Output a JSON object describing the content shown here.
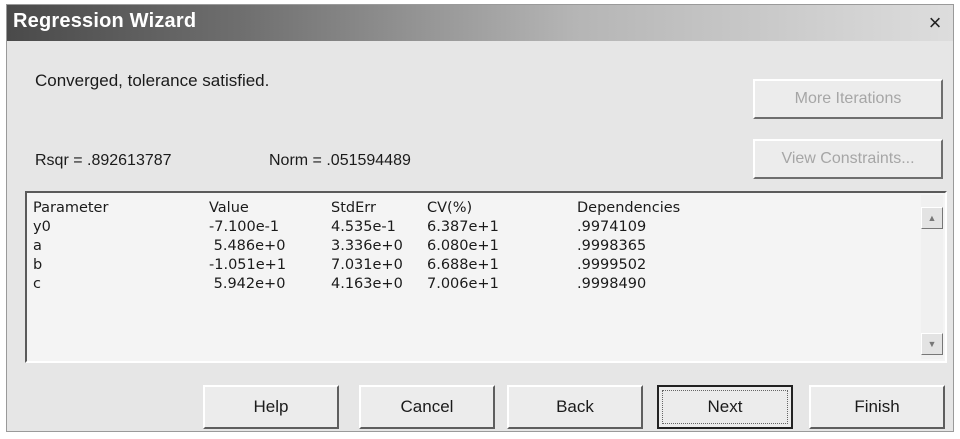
{
  "window": {
    "title": "Regression Wizard",
    "close_label": "×"
  },
  "status": "Converged, tolerance satisfied.",
  "stats": {
    "rsqr": "Rsqr = .892613787",
    "norm": "Norm = .051594489"
  },
  "side_buttons": {
    "more_iterations": "More Iterations",
    "view_constraints": "View Constraints..."
  },
  "results": {
    "headers": [
      "Parameter",
      "Value",
      "StdErr",
      "CV(%)",
      "Dependencies"
    ],
    "rows": [
      [
        "y0",
        "-7.100e-1",
        "4.535e-1",
        "6.387e+1",
        ".9974109"
      ],
      [
        "a",
        " 5.486e+0",
        "3.336e+0",
        "6.080e+1",
        ".9998365"
      ],
      [
        "b",
        "-1.051e+1",
        "7.031e+0",
        "6.688e+1",
        ".9999502"
      ],
      [
        "c",
        " 5.942e+0",
        "4.163e+0",
        "7.006e+1",
        ".9998490"
      ]
    ]
  },
  "scroll": {
    "up_icon": "▲",
    "down_icon": "▼"
  },
  "buttons": {
    "help": "Help",
    "cancel": "Cancel",
    "back": "Back",
    "next": "Next",
    "finish": "Finish"
  }
}
